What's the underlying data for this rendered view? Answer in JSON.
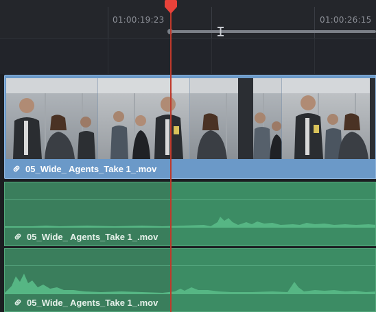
{
  "ruler": {
    "timecode_1": "01:00:19:23",
    "timecode_2": "01:00:26:15"
  },
  "video_track": {
    "clip_name": "05_Wide_ Agents_Take 1_.mov",
    "color": "#6b99c8"
  },
  "audio_tracks": [
    {
      "clip_name": "05_Wide_ Agents_Take 1_.mov"
    },
    {
      "clip_name": "05_Wide_ Agents_Take 1_.mov"
    }
  ],
  "colors": {
    "playhead": "#c0392b",
    "audio_clip": "#3c8c64",
    "video_clip": "#6b99c8"
  },
  "icons": {
    "link": "link-icon",
    "playhead": "playhead-marker-icon",
    "in_out_handle": "ibeam-handle-icon"
  }
}
